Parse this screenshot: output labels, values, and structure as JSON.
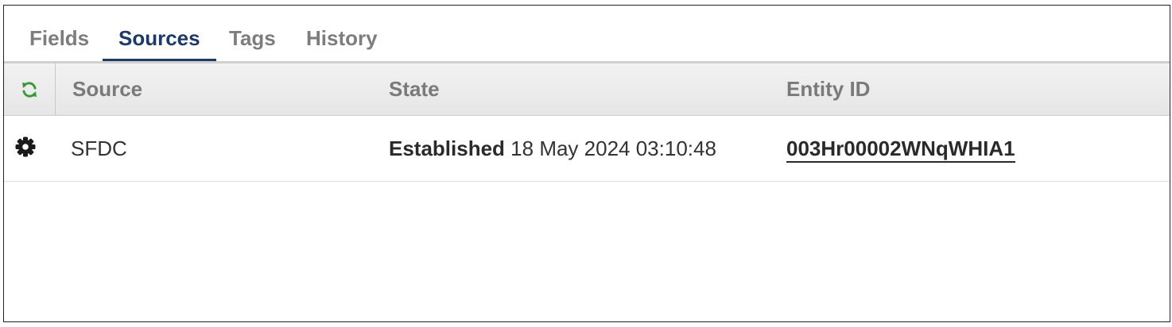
{
  "tabs": [
    {
      "label": "Fields",
      "active": false
    },
    {
      "label": "Sources",
      "active": true
    },
    {
      "label": "Tags",
      "active": false
    },
    {
      "label": "History",
      "active": false
    }
  ],
  "table": {
    "columns": {
      "refresh_icon": "refresh-icon",
      "source": "Source",
      "state": "State",
      "entity_id": "Entity ID"
    },
    "rows": [
      {
        "action_icon": "gear-icon",
        "source": "SFDC",
        "state_label": "Established",
        "state_time": "18 May 2024 03:10:48",
        "entity_id": "003Hr00002WNqWHIA1"
      }
    ]
  },
  "colors": {
    "active_tab": "#1d3a66",
    "refresh_icon": "#3a9a3a"
  }
}
